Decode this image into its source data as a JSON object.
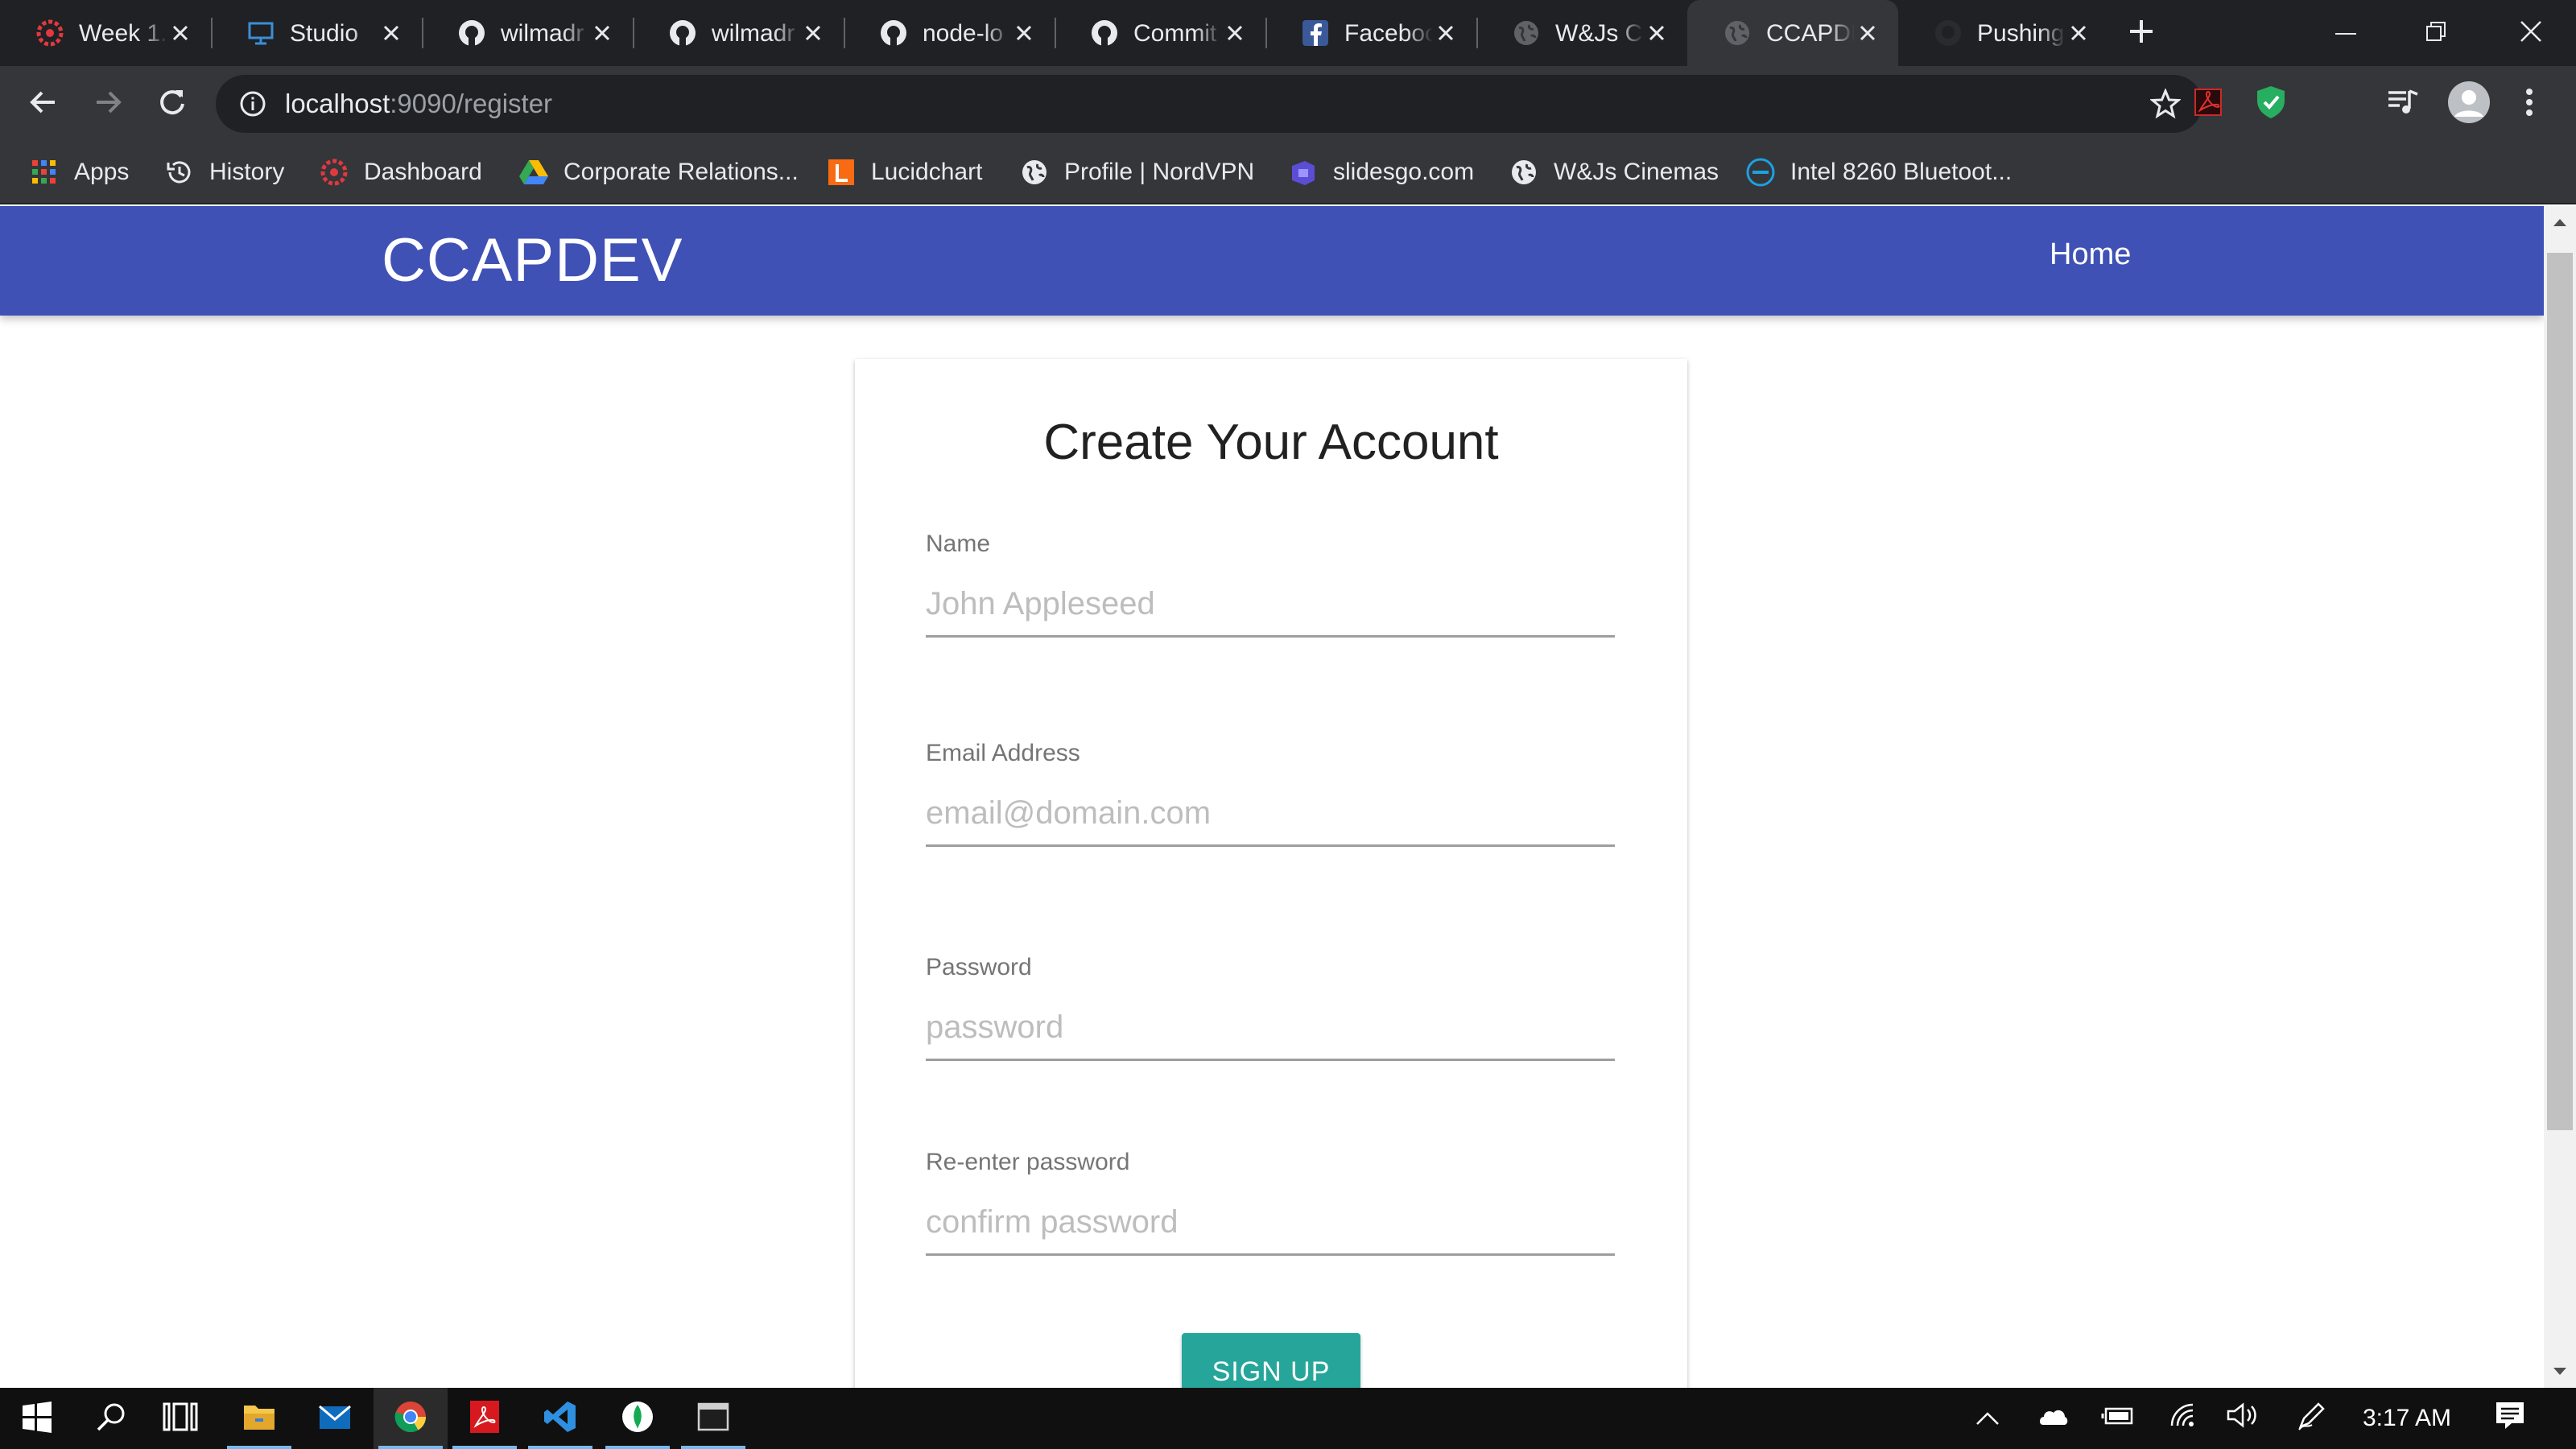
{
  "browser": {
    "tabs": [
      {
        "title": "Week 1...",
        "favicon": "red-gear-icon"
      },
      {
        "title": "Studio",
        "favicon": "studio-monitor-icon"
      },
      {
        "title": "wilmadr",
        "favicon": "github-icon"
      },
      {
        "title": "wilmadr",
        "favicon": "github-icon"
      },
      {
        "title": "node-lo",
        "favicon": "github-icon"
      },
      {
        "title": "Commit",
        "favicon": "github-icon"
      },
      {
        "title": "Facebook",
        "favicon": "facebook-icon"
      },
      {
        "title": "W&Js C",
        "favicon": "globe-icon"
      },
      {
        "title": "CCAPDEV",
        "favicon": "globe-icon",
        "active": true
      },
      {
        "title": "Pushing",
        "favicon": "github-icon"
      }
    ],
    "url": {
      "host": "localhost",
      "path": ":9090/register"
    },
    "bookmarks": [
      {
        "label": "Apps",
        "icon": "apps-grid-icon"
      },
      {
        "label": "History",
        "icon": "history-icon"
      },
      {
        "label": "Dashboard",
        "icon": "red-gear-icon"
      },
      {
        "label": "Corporate Relations...",
        "icon": "google-drive-icon"
      },
      {
        "label": "Lucidchart",
        "icon": "lucidchart-icon"
      },
      {
        "label": "Profile | NordVPN",
        "icon": "globe-icon"
      },
      {
        "label": "slidesgo.com",
        "icon": "slidesgo-icon"
      },
      {
        "label": "W&Js Cinemas",
        "icon": "globe-icon"
      },
      {
        "label": "Intel 8260 Bluetoot...",
        "icon": "dell-icon"
      }
    ]
  },
  "navbar": {
    "brand": "CCAPDEV",
    "home_link": "Home"
  },
  "form": {
    "title": "Create Your Account",
    "fields": [
      {
        "label": "Name",
        "placeholder": "John Appleseed",
        "type": "text"
      },
      {
        "label": "Email Address",
        "placeholder": "email@domain.com",
        "type": "email"
      },
      {
        "label": "Password",
        "placeholder": "password",
        "type": "password"
      },
      {
        "label": "Re-enter password",
        "placeholder": "confirm password",
        "type": "password"
      }
    ],
    "submit_label": "SIGN UP"
  },
  "taskbar": {
    "time": "3:17 AM",
    "apps": [
      "start-icon",
      "search-icon",
      "task-view-icon",
      "file-explorer-icon",
      "mail-icon",
      "chrome-icon",
      "acrobat-icon",
      "vscode-icon",
      "mongodb-icon",
      "terminal-icon"
    ]
  },
  "colors": {
    "navbar": "#3f51b5",
    "button": "#26a69a",
    "tab_bg": "#202124",
    "toolbar_bg": "#35363a"
  }
}
